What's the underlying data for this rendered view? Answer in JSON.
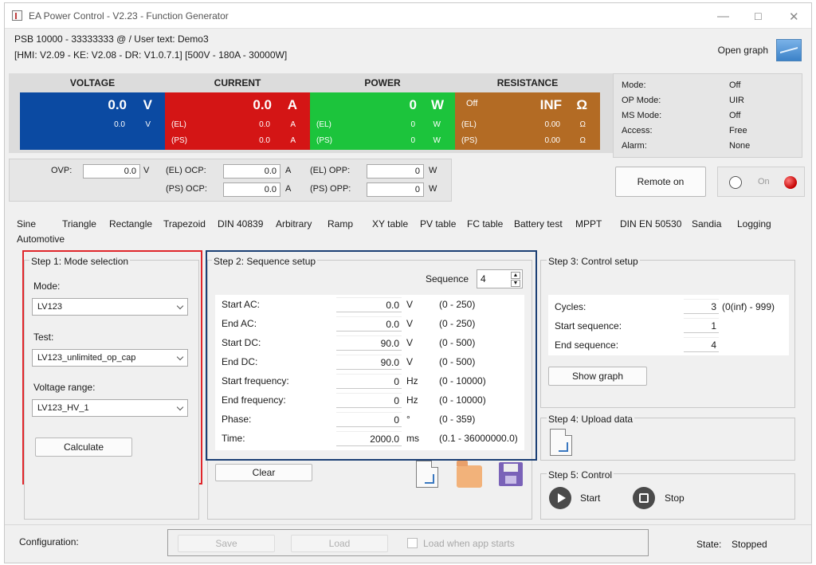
{
  "window": {
    "title": "EA Power Control - V2.23 - Function Generator"
  },
  "header": {
    "device_line": "PSB 10000 - 33333333 @ / User text: Demo3",
    "info_line": "[HMI: V2.09 - KE: V2.08 - DR: V1.0.7.1] [500V - 180A - 30000W]",
    "open_graph_label": "Open graph"
  },
  "meters": {
    "voltage": {
      "label": "VOLTAGE",
      "value": "0.0",
      "unit": "V",
      "sub_value": "0.0",
      "sub_unit": "V",
      "color": "#0b4aa2"
    },
    "current": {
      "label": "CURRENT",
      "value": "0.0",
      "unit": "A",
      "el_tag": "(EL)",
      "el_value": "0.0",
      "el_unit": "A",
      "ps_tag": "(PS)",
      "ps_value": "0.0",
      "ps_unit": "A",
      "color": "#d41515"
    },
    "power": {
      "label": "POWER",
      "value": "0",
      "unit": "W",
      "el_tag": "(EL)",
      "el_value": "0",
      "el_unit": "W",
      "ps_tag": "(PS)",
      "ps_value": "0",
      "ps_unit": "W",
      "color": "#1cc43c"
    },
    "resistance": {
      "label": "RESISTANCE",
      "off_text": "Off",
      "value": "INF",
      "unit": "Ω",
      "el_tag": "(EL)",
      "el_value": "0.00",
      "el_unit": "Ω",
      "ps_tag": "(PS)",
      "ps_value": "0.00",
      "ps_unit": "Ω",
      "color": "#b36b24"
    }
  },
  "status": {
    "rows": [
      {
        "key": "Mode:",
        "value": "Off"
      },
      {
        "key": "OP Mode:",
        "value": "UIR"
      },
      {
        "key": "MS Mode:",
        "value": "Off"
      },
      {
        "key": "Access:",
        "value": "Free"
      },
      {
        "key": "Alarm:",
        "value": "None"
      }
    ]
  },
  "protection": {
    "ovp_label": "OVP:",
    "ovp_value": "0.0",
    "ovp_unit": "V",
    "el_ocp_label": "(EL) OCP:",
    "el_ocp_value": "0.0",
    "el_ocp_unit": "A",
    "ps_ocp_label": "(PS) OCP:",
    "ps_ocp_value": "0.0",
    "ps_ocp_unit": "A",
    "el_opp_label": "(EL) OPP:",
    "el_opp_value": "0",
    "el_opp_unit": "W",
    "ps_opp_label": "(PS) OPP:",
    "ps_opp_value": "0",
    "ps_opp_unit": "W"
  },
  "remote": {
    "button_label": "Remote on",
    "on_label": "On"
  },
  "tabs": [
    "Sine",
    "Triangle",
    "Rectangle",
    "Trapezoid",
    "DIN 40839",
    "Arbitrary",
    "Ramp",
    "XY table",
    "PV table",
    "FC table",
    "Battery test",
    "MPPT",
    "DIN EN 50530",
    "Sandia",
    "Logging",
    "Automotive"
  ],
  "step1": {
    "title": "Step 1: Mode selection",
    "mode_label": "Mode:",
    "mode_value": "LV123",
    "test_label": "Test:",
    "test_value": "LV123_unlimited_op_cap",
    "range_label": "Voltage range:",
    "range_value": "LV123_HV_1",
    "calculate_label": "Calculate"
  },
  "step2": {
    "title": "Step 2: Sequence setup",
    "sequence_label": "Sequence",
    "sequence_value": "4",
    "rows": [
      {
        "label": "Start AC:",
        "value": "0.0",
        "unit": "V",
        "range": "(0 - 250)"
      },
      {
        "label": "End AC:",
        "value": "0.0",
        "unit": "V",
        "range": "(0 - 250)"
      },
      {
        "label": "Start DC:",
        "value": "90.0",
        "unit": "V",
        "range": "(0 - 500)"
      },
      {
        "label": "End DC:",
        "value": "90.0",
        "unit": "V",
        "range": "(0 - 500)"
      },
      {
        "label": "Start frequency:",
        "value": "0",
        "unit": "Hz",
        "range": "(0 - 10000)"
      },
      {
        "label": "End frequency:",
        "value": "0",
        "unit": "Hz",
        "range": "(0 - 10000)"
      },
      {
        "label": "Phase:",
        "value": "0",
        "unit": "°",
        "range": "(0 - 359)"
      },
      {
        "label": "Time:",
        "value": "2000.0",
        "unit": "ms",
        "range": "(0.1 - 36000000.0)"
      }
    ],
    "clear_label": "Clear"
  },
  "step3": {
    "title": "Step 3: Control setup",
    "cycles_label": "Cycles:",
    "cycles_value": "3",
    "cycles_range": "(0(inf) - 999)",
    "start_seq_label": "Start sequence:",
    "start_seq_value": "1",
    "end_seq_label": "End sequence:",
    "end_seq_value": "4",
    "show_graph_label": "Show graph"
  },
  "step4": {
    "title": "Step 4: Upload data"
  },
  "step5": {
    "title": "Step 5: Control",
    "start_label": "Start",
    "stop_label": "Stop"
  },
  "footer": {
    "config_label": "Configuration:",
    "save_label": "Save",
    "load_label": "Load",
    "load_on_start_label": "Load when app starts",
    "state_label": "State:",
    "state_value": "Stopped"
  }
}
